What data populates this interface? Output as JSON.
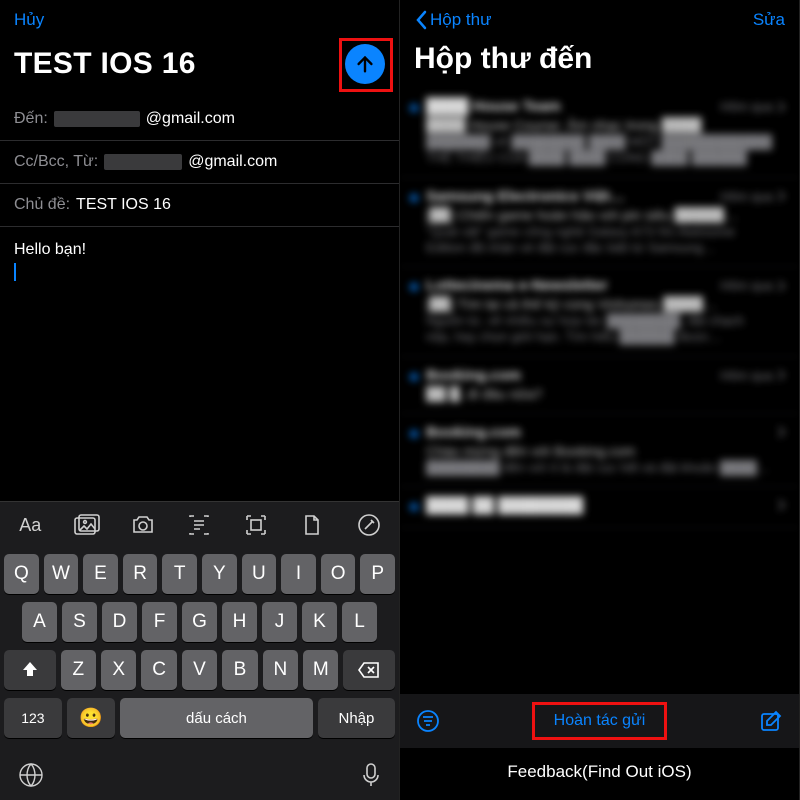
{
  "left": {
    "cancel": "Hủy",
    "subject_large": "TEST IOS 16",
    "to_label": "Đến:",
    "to_value_visible": "@gmail.com",
    "cc_label": "Cc/Bcc, Từ:",
    "cc_value_visible": "@gmail.com",
    "subj_label": "Chủ đề:",
    "subj_value": "TEST IOS 16",
    "body": "Hello bạn!",
    "toolbar_icons": [
      "Aa",
      "gallery-icon",
      "camera-icon",
      "scan-icon",
      "doc-scan-icon",
      "file-icon",
      "markup-icon"
    ],
    "keyboard": {
      "row1": [
        "Q",
        "W",
        "E",
        "R",
        "T",
        "Y",
        "U",
        "I",
        "O",
        "P"
      ],
      "row2": [
        "A",
        "S",
        "D",
        "F",
        "G",
        "H",
        "J",
        "K",
        "L"
      ],
      "row3": [
        "Z",
        "X",
        "C",
        "V",
        "B",
        "N",
        "M"
      ],
      "shift": "⇧",
      "backspace": "⌫",
      "numkey": "123",
      "emoji": "😀",
      "space": "dấu cách",
      "return": "Nhập"
    }
  },
  "right": {
    "back": "Hộp thư",
    "edit": "Sửa",
    "title": "Hộp thư đến",
    "undo": "Hoàn tác gửi",
    "feedback": "Feedback(Find Out iOS)",
    "mail_items": [
      {
        "sender": "████ House Team",
        "time": "Hôm qua",
        "subject": "████ House Course: Âm nhạc trong ████",
        "preview": "███████ về ████████ ████ MỘT ████████████\nTHẺ THIẾU CỦA ████ ████ CÙNG ████ ██████"
      },
      {
        "sender": "Samsung Electronics Việt…",
        "time": "Hôm qua",
        "subject": "[██] Chiến game hoàn hảo với pin siêu █████…",
        "preview": "\"Quái vật\" game công nghệ Galaxy A73 5G Awesome\nEdition đã nhận vé đặt cọc đặc biệt từ Samsung…"
      },
      {
        "sender": "Lottecinema e-Newsletter",
        "time": "Hôm qua",
        "subject": "[██] Tìm lại cả thế kỷ cùng Vinhomes ████…",
        "preview": "Nguồn từ, về nhiều sự hợp tác ████████, đặt chạch\nnộp, hay chọn giới hạn. Tìm hiểu ██████ được…"
      },
      {
        "sender": "Booking.com",
        "time": "Hôm qua",
        "subject": "██ █, đi đâu nữa?",
        "preview": ""
      },
      {
        "sender": "Booking.com",
        "time": "",
        "subject": "Chào mừng đến với Booking.com",
        "preview": "████████ đến với ít là đặt cọc hết và đặt khoản ████…"
      },
      {
        "sender": "████ ██ ████████",
        "time": "",
        "subject": "",
        "preview": ""
      }
    ]
  },
  "colors": {
    "accent": "#0a84ff",
    "highlight": "#e11"
  }
}
